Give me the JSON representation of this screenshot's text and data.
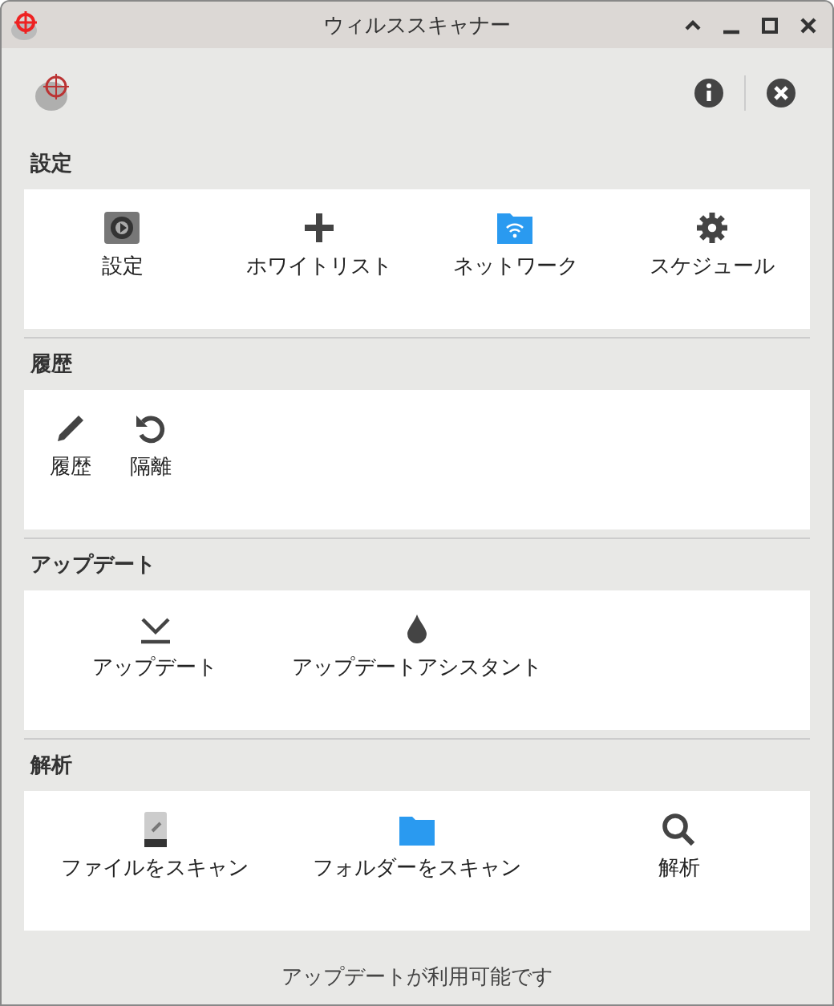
{
  "window": {
    "title": "ウィルススキャナー"
  },
  "sections": [
    {
      "title": "設定",
      "kind": "grid",
      "items": [
        {
          "label": "設定",
          "kind": "settings-app"
        },
        {
          "label": "ホワイトリスト",
          "kind": "plus"
        },
        {
          "label": "ネットワーク",
          "kind": "network-folder"
        },
        {
          "label": "スケジュール",
          "kind": "gear"
        }
      ]
    },
    {
      "title": "履歴",
      "kind": "compact",
      "items": [
        {
          "label": "履歴",
          "kind": "pencil"
        },
        {
          "label": "隔離",
          "kind": "undo"
        }
      ]
    },
    {
      "title": "アップデート",
      "kind": "grid",
      "items": [
        {
          "label": "アップデート",
          "kind": "download"
        },
        {
          "label": "アップデートアシスタント",
          "kind": "drop"
        }
      ]
    },
    {
      "title": "解析",
      "kind": "grid",
      "items": [
        {
          "label": "ファイルをスキャン",
          "kind": "file"
        },
        {
          "label": "フォルダーをスキャン",
          "kind": "folder"
        },
        {
          "label": "解析",
          "kind": "search"
        }
      ]
    }
  ],
  "status": "アップデートが利用可能です"
}
